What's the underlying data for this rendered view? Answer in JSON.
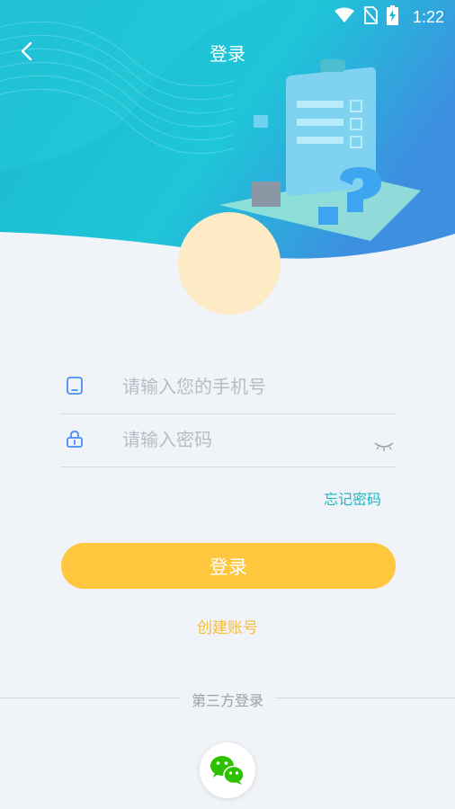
{
  "status_bar": {
    "time": "1:22",
    "icons": [
      "wifi-icon",
      "no-sim-icon",
      "battery-charging-icon"
    ]
  },
  "nav": {
    "title": "登录",
    "back_icon": "chevron-left-icon"
  },
  "form": {
    "phone": {
      "placeholder": "请输入您的手机号",
      "value": "",
      "icon": "phone-icon"
    },
    "password": {
      "placeholder": "请输入密码",
      "value": "",
      "icon": "lock-icon",
      "toggle_icon": "eye-closed-icon"
    },
    "forgot_label": "忘记密码",
    "login_label": "登录",
    "create_account_label": "创建账号"
  },
  "third_party": {
    "label": "第三方登录",
    "providers": [
      "wechat-icon"
    ]
  },
  "colors": {
    "header_teal": "#1cc4d6",
    "accent_yellow": "#fec73d",
    "link_teal": "#1fb8c3",
    "background": "#f0f3f8",
    "avatar_bg": "#fdebc5"
  }
}
